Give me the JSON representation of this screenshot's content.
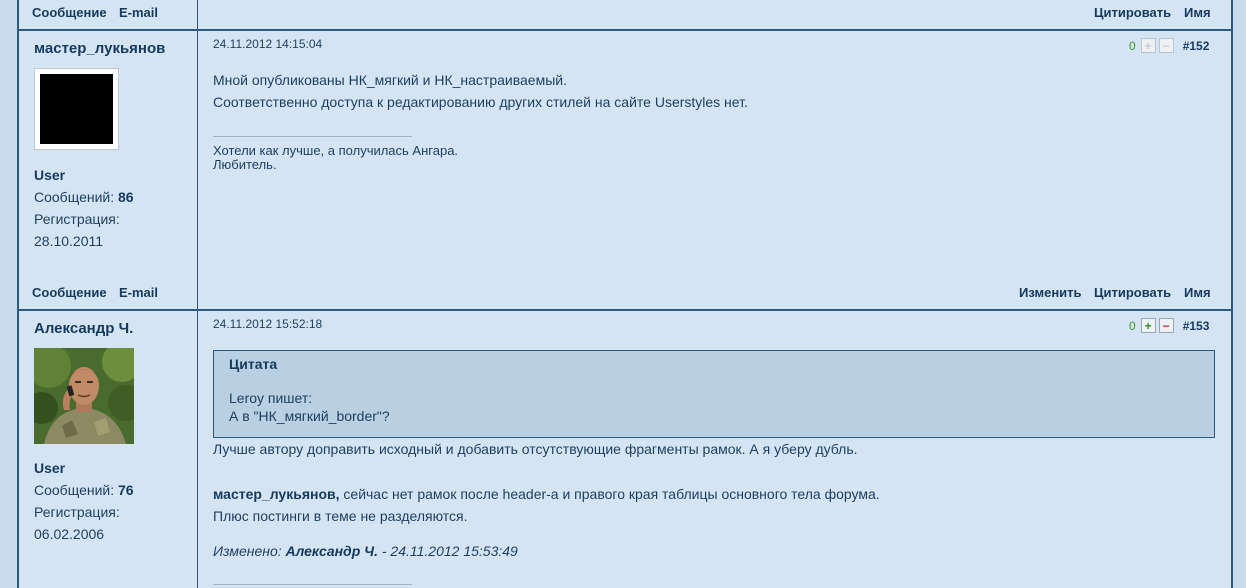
{
  "top_bar": {
    "left_links": [
      "Сообщение",
      "E-mail"
    ],
    "right_links": [
      "Цитировать",
      "Имя"
    ]
  },
  "posts": [
    {
      "author": "мастер_лукьянов",
      "role": "User",
      "messages_label": "Сообщений:",
      "messages_count": "86",
      "registration_label": "Регистрация:",
      "registration_date": "28.10.2011",
      "date": "24.11.2012 14:15:04",
      "vote_count": "0",
      "number": "#152",
      "lines": [
        "Мной опубликованы НК_мягкий и НК_настраиваемый.",
        "Соответственно доступа к редактированию других стилей на сайте Userstyles  нет."
      ],
      "signature": [
        "Хотели как лучше, а получилась Ангара.",
        "Любитель."
      ],
      "footer_left": [
        "Сообщение",
        "E-mail"
      ],
      "footer_right": [
        "Изменить",
        "Цитировать",
        "Имя"
      ]
    },
    {
      "author": "Александр Ч.",
      "role": "User",
      "messages_label": "Сообщений:",
      "messages_count": "76",
      "registration_label": "Регистрация:",
      "registration_date": "06.02.2006",
      "date": "24.11.2012 15:52:18",
      "vote_count": "0",
      "number": "#153",
      "quote": {
        "title": "Цитата",
        "author_line": "Leroy пишет:",
        "text": "А в \"НК_мягкий_border\"?"
      },
      "line1": "Лучше автору доправить исходный и добавить отсутствующие фрагменты рамок. А я уберу дубль.",
      "mention": "мастер_лукьянов,",
      "line2_rest": "  сейчас нет рамок после header-а и правого края таблицы основного тела форума.",
      "line3": "Плюс постинги в теме не разделяются.",
      "edited_label": "Изменено:",
      "edited_by": "Александр Ч.",
      "edited_when": "- 24.11.2012 15:53:49"
    }
  ],
  "vote_symbols": {
    "plus": "+",
    "minus": "−"
  },
  "colors": {
    "accent": "#2c5a82",
    "background": "#d4e4f3",
    "quote_bg": "#b9cfe2",
    "vote_positive": "#3a9a2c"
  }
}
